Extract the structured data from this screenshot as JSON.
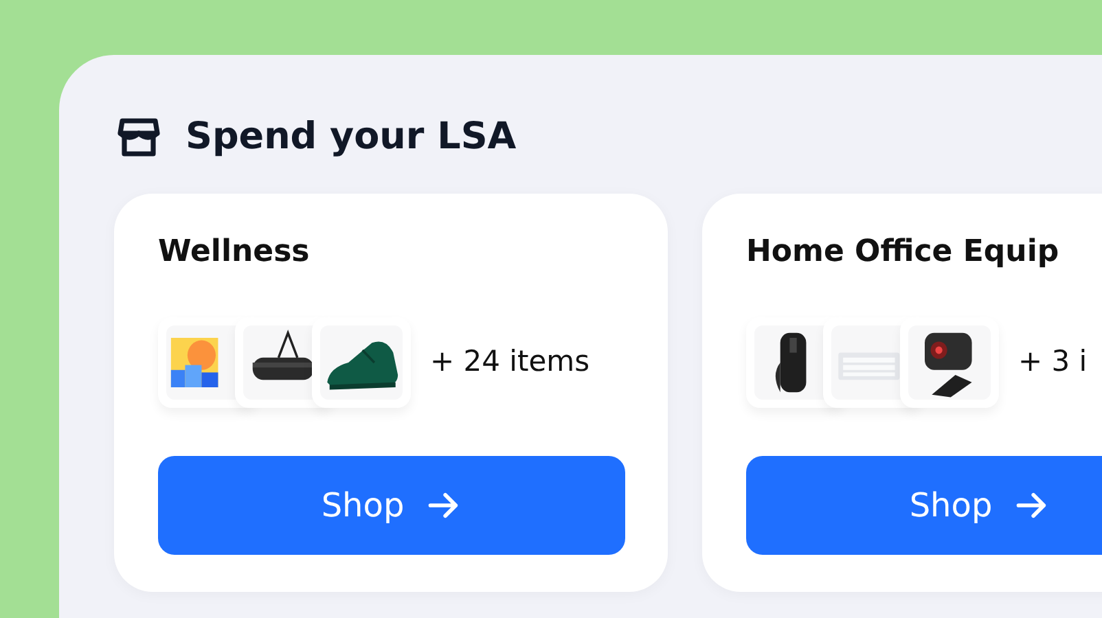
{
  "heading": "Spend your LSA",
  "categories": [
    {
      "title": "Wellness",
      "more": "+ 24 items",
      "button": "Shop"
    },
    {
      "title": "Home Office Equip",
      "more": "+ 3 i",
      "button": "Shop"
    }
  ]
}
